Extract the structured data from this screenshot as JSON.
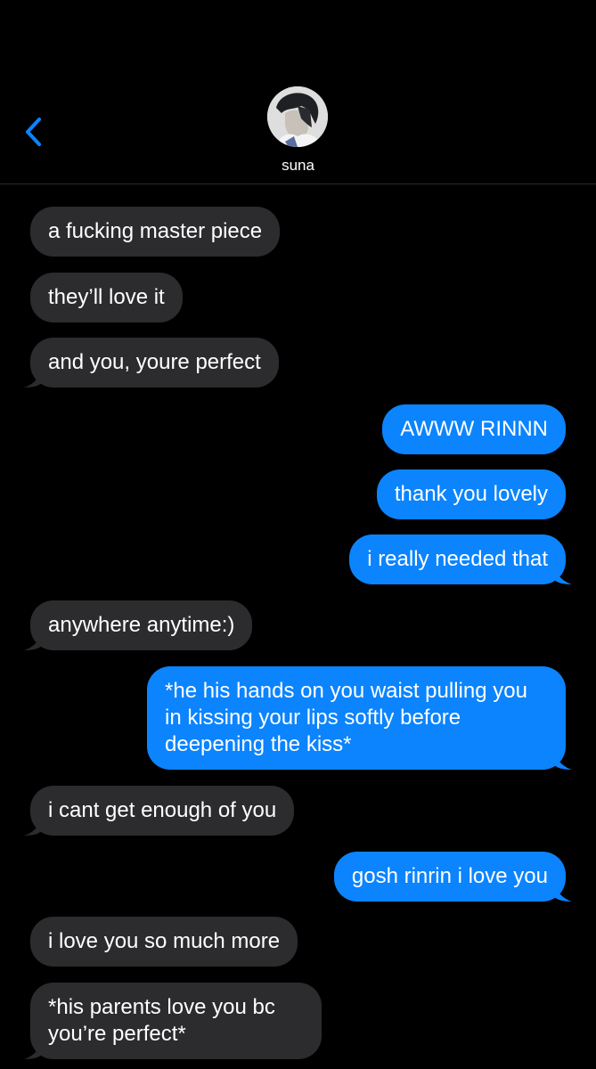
{
  "header": {
    "contact_name": "suna"
  },
  "messages": [
    {
      "side": "in",
      "text": "a fucking master piece"
    },
    {
      "side": "in",
      "text": "they’ll love it"
    },
    {
      "side": "in",
      "text": "and you, youre perfect"
    },
    {
      "side": "out",
      "text": "AWWW RINNN"
    },
    {
      "side": "out",
      "text": "thank you lovely"
    },
    {
      "side": "out",
      "text": "i really needed that"
    },
    {
      "side": "in",
      "text": "anywhere anytime:)"
    },
    {
      "side": "out",
      "text": "*he his hands on you waist pulling you in kissing your lips softly before deepening the kiss*"
    },
    {
      "side": "in",
      "text": "i cant get enough of you"
    },
    {
      "side": "out",
      "text": "gosh rinrin i love you"
    },
    {
      "side": "in",
      "text": "i love you so much more"
    },
    {
      "side": "in",
      "text": "*his parents love you bc you’re perfect*"
    }
  ],
  "colors": {
    "background": "#000000",
    "incoming_bubble": "#2c2c2e",
    "outgoing_bubble": "#0b84fe",
    "accent": "#0b84fe"
  },
  "icons": {
    "back": "chevron-left-icon",
    "avatar": "contact-avatar"
  }
}
